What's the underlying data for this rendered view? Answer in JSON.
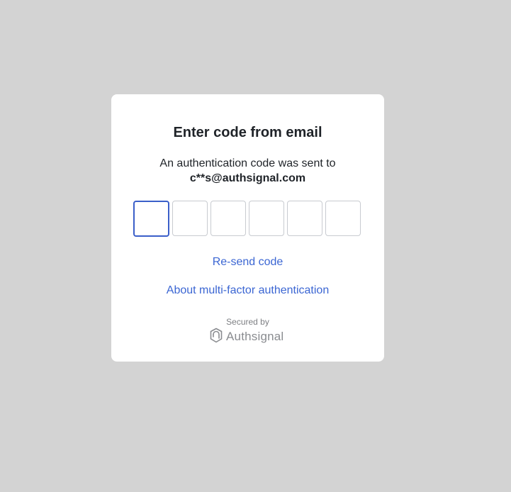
{
  "dialog": {
    "title": "Enter code from email",
    "subtitle": "An authentication code was sent to",
    "email": "c**s@authsignal.com",
    "code_inputs": [
      "",
      "",
      "",
      "",
      "",
      ""
    ],
    "resend_label": "Re-send code",
    "about_label": "About multi-factor authentication",
    "secured_by": "Secured by",
    "brand_name": "Authsignal",
    "brand_icon": "authsignal-logo-icon"
  },
  "colors": {
    "background": "#d3d3d3",
    "card": "#ffffff",
    "link": "#3b66d3",
    "focus_border": "#3b5fc9",
    "text": "#1f2328",
    "muted": "#7d7f83"
  }
}
